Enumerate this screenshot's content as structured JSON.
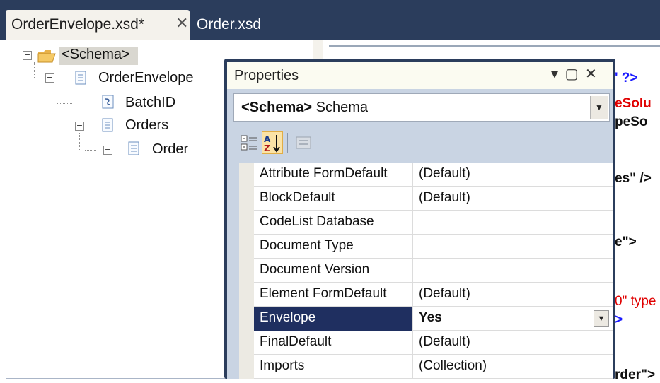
{
  "tabs": [
    {
      "label": "OrderEnvelope.xsd*",
      "close": "✕"
    },
    {
      "label": "Order.xsd"
    }
  ],
  "tree": {
    "schema": "<Schema>",
    "order_envelope": "OrderEnvelope",
    "batch_id": "BatchID",
    "orders": "Orders",
    "order": "Order"
  },
  "editor_code": [
    {
      "text": "' ?>",
      "color": "#1a1aff"
    },
    {
      "text": "eSolu",
      "color": "#e00000"
    },
    {
      "text": "peSo",
      "color": "#111111"
    },
    {
      "text": "es\" />",
      "color": "#111111"
    },
    {
      "text": "e\">",
      "color": "#111111"
    },
    {
      "text": "0\" type",
      "color": "#e00000"
    },
    {
      "text": ">",
      "color": "#1a1aff"
    },
    {
      "text": "rder\">",
      "color": "#111111"
    }
  ],
  "properties": {
    "title": "Properties",
    "window_buttons": "▾ ▢ ✕",
    "object_tag": "<Schema>",
    "object_type": "Schema",
    "dropdown_arrow": "▼",
    "rows": [
      {
        "name": "Attribute FormDefault",
        "value": "(Default)"
      },
      {
        "name": "BlockDefault",
        "value": "(Default)"
      },
      {
        "name": "CodeList Database",
        "value": ""
      },
      {
        "name": "Document Type",
        "value": ""
      },
      {
        "name": "Document Version",
        "value": ""
      },
      {
        "name": "Element FormDefault",
        "value": "(Default)"
      },
      {
        "name": "Envelope",
        "value": "Yes"
      },
      {
        "name": "FinalDefault",
        "value": "(Default)"
      },
      {
        "name": "Imports",
        "value": "(Collection)"
      }
    ],
    "selected_row": "Envelope"
  },
  "colors": {
    "chrome": "#2b3d5c",
    "selection": "#1f2f60",
    "panel": "#c9d4e3"
  }
}
